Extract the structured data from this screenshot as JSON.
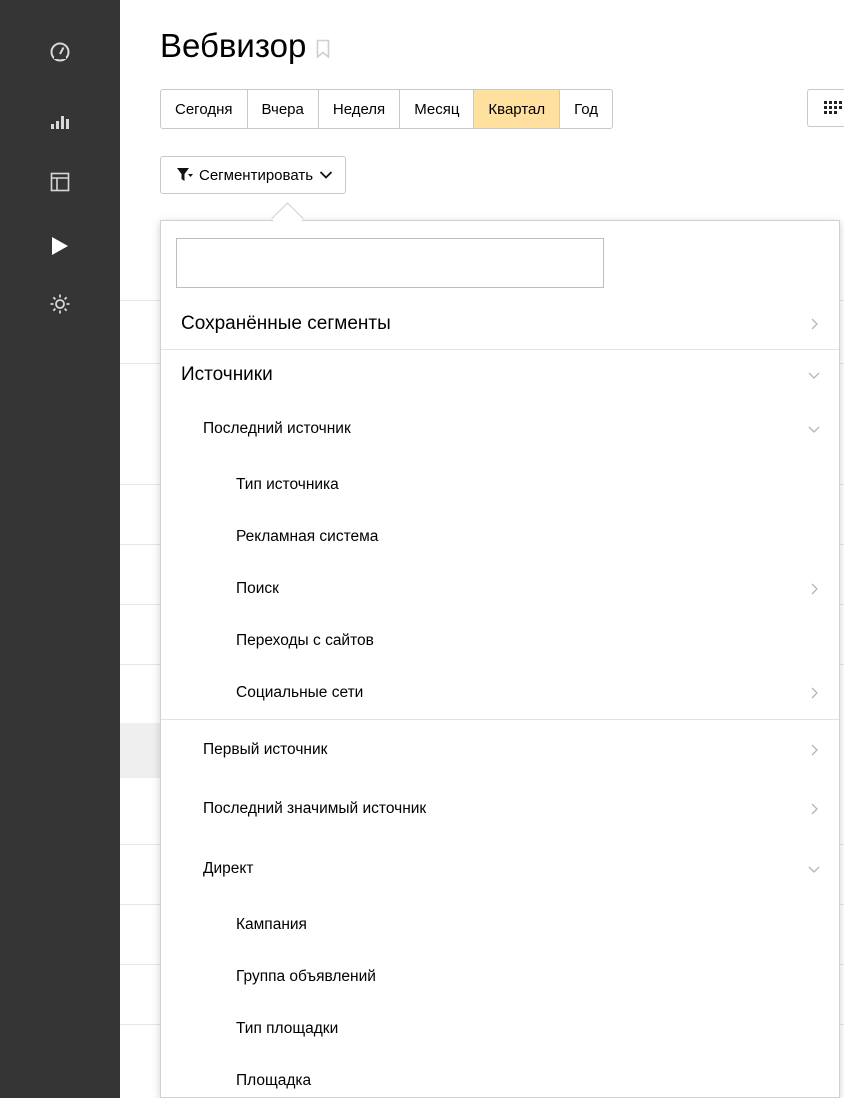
{
  "page": {
    "title": "Вебвизор",
    "accent_color": "#ffe09e",
    "sidebar_color": "#353535"
  },
  "sidebar": {
    "items": [
      {
        "icon": "dashboard-icon"
      },
      {
        "icon": "reports-icon"
      },
      {
        "icon": "layout-icon"
      },
      {
        "icon": "play-icon",
        "active": true
      },
      {
        "icon": "gear-icon"
      }
    ]
  },
  "periods": {
    "items": [
      "Сегодня",
      "Вчера",
      "Неделя",
      "Месяц",
      "Квартал",
      "Год"
    ],
    "active": "Квартал"
  },
  "segment": {
    "label": "Сегментировать"
  },
  "dropdown": {
    "search_value": "",
    "items": [
      {
        "label": "Сохранённые сегменты",
        "level": 0,
        "chevron": "right"
      },
      {
        "label": "Источники",
        "level": 0,
        "chevron": "down"
      },
      {
        "label": "Последний источник",
        "level": 1,
        "chevron": "down"
      },
      {
        "label": "Тип источника",
        "level": 2,
        "chevron": ""
      },
      {
        "label": "Рекламная система",
        "level": 2,
        "chevron": ""
      },
      {
        "label": "Поиск",
        "level": 2,
        "chevron": "right"
      },
      {
        "label": "Переходы с сайтов",
        "level": 2,
        "chevron": ""
      },
      {
        "label": "Социальные сети",
        "level": 2,
        "chevron": "right"
      },
      {
        "label": "Первый источник",
        "level": 1,
        "chevron": "right"
      },
      {
        "label": "Последний значимый источник",
        "level": 1,
        "chevron": "right"
      },
      {
        "label": "Директ",
        "level": 1,
        "chevron": "down"
      },
      {
        "label": "Кампания",
        "level": 2,
        "chevron": ""
      },
      {
        "label": "Группа объявлений",
        "level": 2,
        "chevron": ""
      },
      {
        "label": "Тип площадки",
        "level": 2,
        "chevron": ""
      },
      {
        "label": "Площадка",
        "level": 2,
        "chevron": ""
      }
    ]
  }
}
